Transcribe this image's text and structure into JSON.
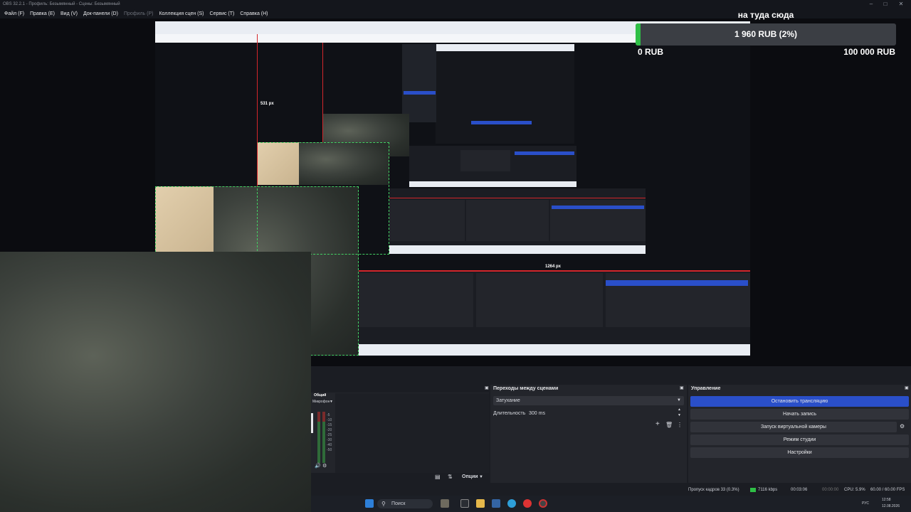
{
  "window": {
    "title": "OBS 32.2.1 - Профиль: Безымянный - Сцены: Безымянный",
    "controls": [
      "minimize",
      "maximize",
      "close"
    ]
  },
  "menu": {
    "items": [
      {
        "label": "Файл (F)",
        "enabled": true
      },
      {
        "label": "Правка (E)",
        "enabled": true
      },
      {
        "label": "Вид (V)",
        "enabled": true
      },
      {
        "label": "Док-панели (D)",
        "enabled": true
      },
      {
        "label": "Профиль (P)",
        "enabled": false
      },
      {
        "label": "Коллекция сцен (S)",
        "enabled": true
      },
      {
        "label": "Сервис (T)",
        "enabled": true
      },
      {
        "label": "Справка (H)",
        "enabled": true
      }
    ]
  },
  "preview": {
    "label_531": "531 px",
    "label_1264": "1264 px"
  },
  "donation_goal": {
    "title": "на туда сюда",
    "progress_text": "1 960 RUB (2%)",
    "progress_fraction": 0.02,
    "min_label": "0 RUB",
    "max_label": "100 000 RUB",
    "fill_color": "#2fbf46"
  },
  "mixer": {
    "tab": "Общий",
    "track": "Микрофон",
    "db_labels": [
      "-5",
      "-10",
      "-15",
      "-20",
      "-25",
      "-30",
      "-40",
      "-50"
    ]
  },
  "transitions": {
    "title": "Переходы между сценами",
    "selected": "Затухание",
    "duration_label": "Длительность",
    "duration_value": "300 ms"
  },
  "controls": {
    "title": "Управление",
    "stop_stream": "Остановить трансляцию",
    "start_record": "Начать запись",
    "virtual_cam": "Запуск виртуальной камеры",
    "studio_mode": "Режим студии",
    "settings": "Настройки"
  },
  "scenes_panel": {
    "options_label": "Опции"
  },
  "status": {
    "dropped": "Пропуск кадров 33 (0.3%)",
    "bitrate": "7116 kbps",
    "stream_time": "00:03:06",
    "record_time": "00:00:00",
    "cpu": "CPU: 5.9%",
    "fps": "60.00 / 60.00 FPS"
  },
  "taskbar": {
    "search_placeholder": "Поиск",
    "lang": "РУС",
    "time": "12:58",
    "date": "12.08.2026"
  },
  "colors": {
    "accent": "#2a4fc9",
    "guide_red": "#d3262b",
    "guide_green": "#43d063"
  }
}
